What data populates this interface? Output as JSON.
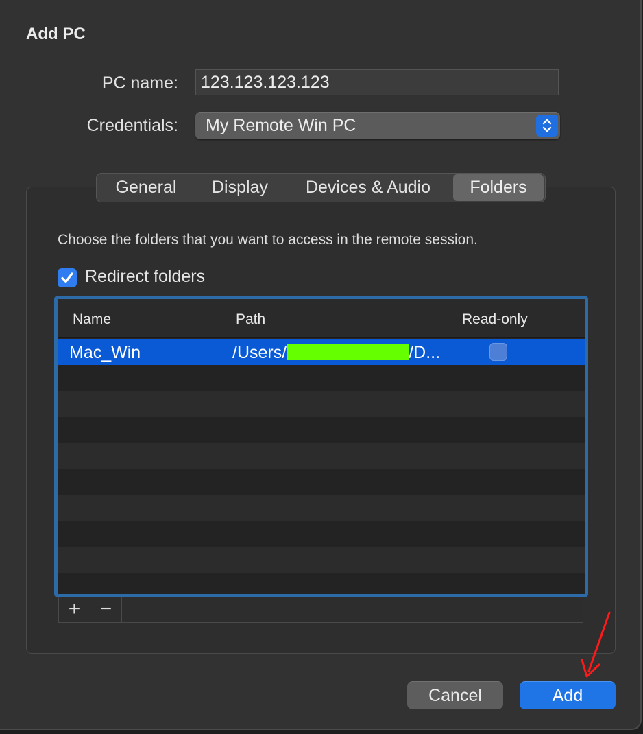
{
  "dialog": {
    "title": "Add PC",
    "pc_name_label": "PC name:",
    "pc_name_value": "123.123.123.123",
    "credentials_label": "Credentials:",
    "credentials_value": "My Remote Win PC"
  },
  "tabs": [
    {
      "label": "General",
      "selected": false
    },
    {
      "label": "Display",
      "selected": false
    },
    {
      "label": "Devices & Audio",
      "selected": false
    },
    {
      "label": "Folders",
      "selected": true
    }
  ],
  "folders": {
    "description": "Choose the folders that you want to access in the remote session.",
    "redirect_label": "Redirect folders",
    "redirect_checked": true,
    "columns": {
      "name": "Name",
      "path": "Path",
      "readonly": "Read-only"
    },
    "rows": [
      {
        "name": "Mac_Win",
        "path_prefix": "/Users/",
        "path_suffix": "/D...",
        "read_only": false,
        "selected": true
      }
    ],
    "add_symbol": "+",
    "remove_symbol": "−"
  },
  "buttons": {
    "cancel": "Cancel",
    "add": "Add"
  },
  "colors": {
    "accent": "#1f74e6",
    "selection": "#0a5ad6",
    "redaction": "#66ff00",
    "annotation_arrow": "#ff1a1a"
  },
  "icons": {
    "popup": "up-down-chevron-icon",
    "checkbox": "checkmark-icon",
    "annotation": "red-arrow-icon"
  }
}
